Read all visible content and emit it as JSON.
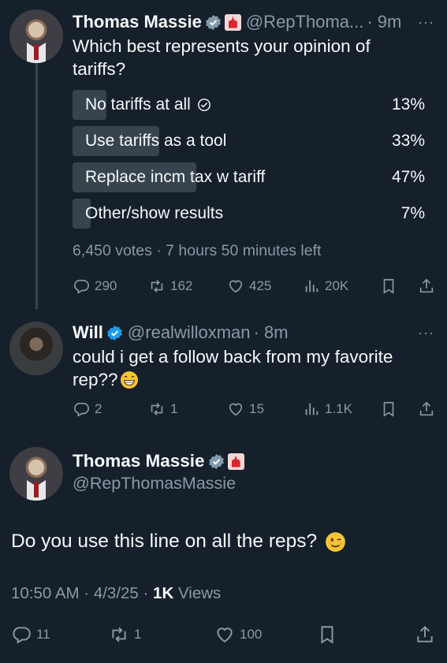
{
  "tweet1": {
    "name": "Thomas Massie",
    "handle": "@RepThoma...",
    "time": "· 9m",
    "more": "···",
    "text_line1": "Which best represents your opinion of",
    "text_line2": "tariffs?",
    "poll": [
      {
        "label": "No tariffs at all",
        "percent": "13%",
        "share": 0.13,
        "selected": true
      },
      {
        "label": "Use tariffs as a tool",
        "percent": "33%",
        "share": 0.33,
        "selected": false
      },
      {
        "label": "Replace incm tax w tariff",
        "percent": "47%",
        "share": 0.47,
        "selected": false
      },
      {
        "label": "Other/show results",
        "percent": "7%",
        "share": 0.07,
        "selected": false
      }
    ],
    "poll_meta": "6,450 votes · 7 hours 50 minutes left",
    "replies": "290",
    "retweets": "162",
    "likes": "425",
    "views": "20K"
  },
  "tweet2": {
    "name": "Will",
    "handle": "@realwilloxman",
    "time": "· 8m",
    "more": "···",
    "text_line1": "could i get a follow back from my favorite",
    "text_line2": "rep??",
    "replies": "2",
    "retweets": "1",
    "likes": "15",
    "views": "1.1K"
  },
  "tweet3": {
    "name": "Thomas Massie",
    "handle": "@RepThomasMassie",
    "text": "Do you use this line on all the reps?",
    "time": "10:50 AM · 4/3/25 · ",
    "views_count": "1K",
    "views_label": " Views",
    "replies": "11",
    "retweets": "1",
    "likes": "100"
  },
  "colors": {
    "background": "#15202b",
    "muted": "#8b98a5",
    "verified": "#1d9bf0",
    "poll_fill": "#38444d"
  }
}
